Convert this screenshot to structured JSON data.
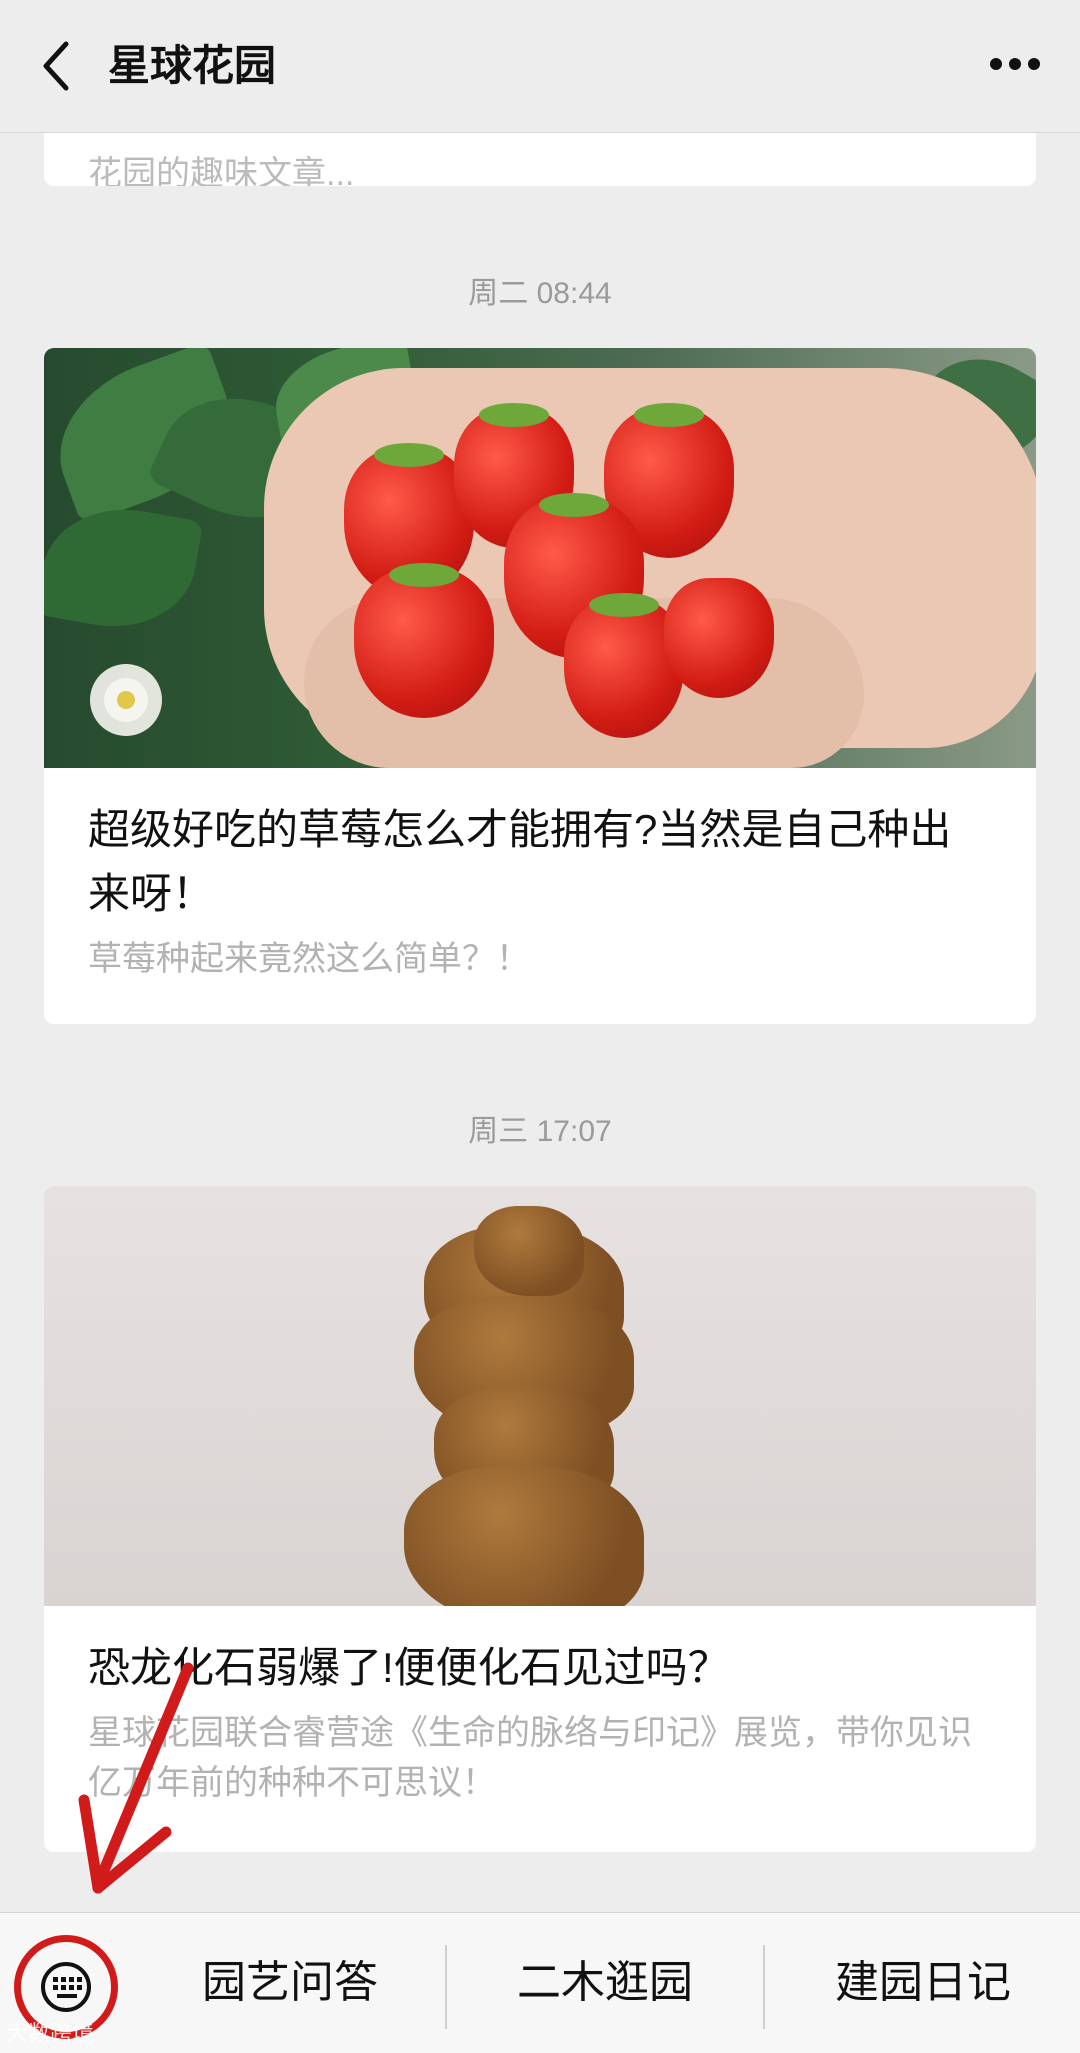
{
  "header": {
    "title": "星球花园"
  },
  "feed": {
    "top_card_snippet": "花园的趣味文章...",
    "articles": [
      {
        "timestamp": "周二 08:44",
        "title": "超级好吃的草莓怎么才能拥有?当然是自己种出来呀！",
        "subtitle": "草莓种起来竟然这么简单？！"
      },
      {
        "timestamp": "周三 17:07",
        "title": "恐龙化石弱爆了!便便化石见过吗？",
        "subtitle": "星球花园联合睿营途《生命的脉络与印记》展览，带你见识亿万年前的种种不可思议！"
      }
    ]
  },
  "bottom_menu": {
    "items": [
      "园艺问答",
      "二木逛园",
      "建园日记"
    ]
  },
  "watermark": "大数跨境",
  "colors": {
    "annotation": "#d11a1a",
    "background": "#ededed"
  }
}
